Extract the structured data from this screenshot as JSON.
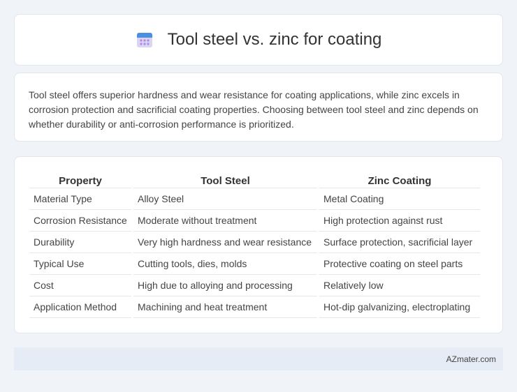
{
  "header": {
    "title": "Tool steel vs. zinc for coating",
    "icon": "calendar-icon"
  },
  "summary": "Tool steel offers superior hardness and wear resistance for coating applications, while zinc excels in corrosion protection and sacrificial coating properties. Choosing between tool steel and zinc depends on whether durability or anti-corrosion performance is prioritized.",
  "table": {
    "headers": [
      "Property",
      "Tool Steel",
      "Zinc Coating"
    ],
    "rows": [
      [
        "Material Type",
        "Alloy Steel",
        "Metal Coating"
      ],
      [
        "Corrosion Resistance",
        "Moderate without treatment",
        "High protection against rust"
      ],
      [
        "Durability",
        "Very high hardness and wear resistance",
        "Surface protection, sacrificial layer"
      ],
      [
        "Typical Use",
        "Cutting tools, dies, molds",
        "Protective coating on steel parts"
      ],
      [
        "Cost",
        "High due to alloying and processing",
        "Relatively low"
      ],
      [
        "Application Method",
        "Machining and heat treatment",
        "Hot-dip galvanizing, electroplating"
      ]
    ]
  },
  "footer": {
    "brand": "AZmater.com"
  },
  "colors": {
    "background": "#f0f3f8",
    "footer_bg": "#e6ecf6",
    "icon_blue": "#4a8fe0",
    "icon_purple": "#b49ae6"
  }
}
